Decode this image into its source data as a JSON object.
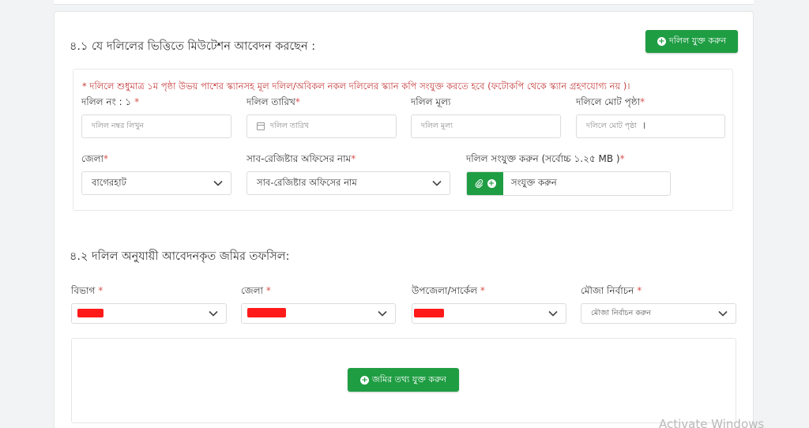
{
  "section1": {
    "title": "৪.১  যে দলিলের ভিত্তিতে মিউটেশন আবেদন করছেন :",
    "add_deed_button": "দলিল যুক্ত করুন",
    "notice": "* দলিলে শুধুমাত্র ১ম পৃষ্ঠা উভয় পাশের স্ক্যানসহ মূল দলিল/অবিকল নকল দলিলের স্ক্যান কপি সংযুক্ত করতে হবে (ফটোকপি থেকে স্ক্যান গ্রহণযোগ্য নয় )।",
    "deed_no": {
      "label": "দলিল নং : ১",
      "required": "*",
      "placeholder": "দলিল নম্বর লিখুন"
    },
    "deed_date": {
      "label": "দলিল তারিখ",
      "required": "*",
      "placeholder": "দলিল তারিখ"
    },
    "deed_value": {
      "label": "দলিল মূল্য",
      "placeholder": "দলিল মূল্য"
    },
    "deed_pages": {
      "label": "দলিলে মোট পৃষ্ঠা",
      "required": "*",
      "placeholder": "দলিলে মোট পৃষ্ঠা"
    },
    "district": {
      "label": "জেলা",
      "required": "*",
      "value": "বাগেরহাট"
    },
    "sub_registry": {
      "label": "সাব-রেজিষ্টার অফিসের নাম",
      "required": "*",
      "value": "সাব-রেজিষ্টার অফিসের নাম"
    },
    "attach": {
      "label": "দলিল সংযুক্ত করুন (সর্বোচ্চ ১.২৫ MB )",
      "required": "*",
      "button_text": "সংযুক্ত করুন"
    }
  },
  "section2": {
    "title": "৪.২  দলিল অনুযায়ী আবেদনকৃত জমির তফসিল:",
    "division": {
      "label": "বিভাগ",
      "required": "*"
    },
    "district": {
      "label": "জেলা",
      "required": "*"
    },
    "upazila": {
      "label": "উপজেলা/সার্কেল",
      "required": "*"
    },
    "mouza": {
      "label": "মৌজা নির্বাচন",
      "required": "*",
      "value": "মৌজা নির্বাচন করুন"
    },
    "add_land_button": "জমির তথ্য যুক্ত করুন"
  },
  "watermark": "Activate Windows",
  "colors": {
    "accent": "#1f9d43",
    "notice": "#c43a3a",
    "required": "#d9534f",
    "redaction": "#ff1a1a"
  },
  "icons": [
    "plus-circle-icon",
    "calendar-icon",
    "paperclip-icon",
    "chevron-down-icon",
    "text-cursor-icon"
  ]
}
